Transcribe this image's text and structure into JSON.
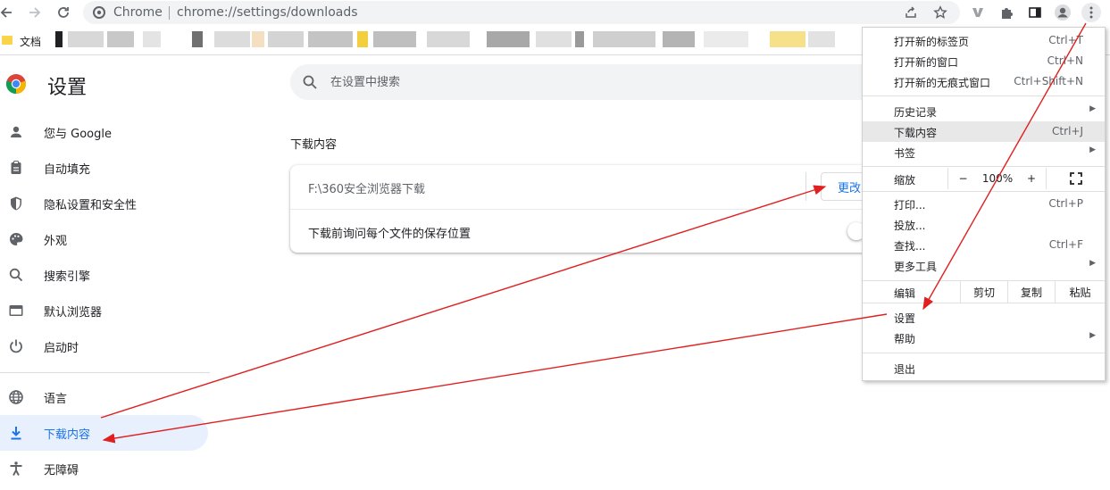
{
  "toolbar": {
    "site_name": "Chrome",
    "url": "chrome://settings/downloads",
    "icons": [
      "back-icon",
      "forward-icon",
      "reload-icon",
      "share-icon",
      "bookmark-star-icon",
      "extension-v-icon",
      "extensions-puzzle-icon",
      "side-panel-icon",
      "profile-icon",
      "menu-kebab-icon"
    ]
  },
  "bookmarks": {
    "first_label": "文档"
  },
  "sidebar": {
    "title": "设置",
    "items": [
      {
        "label": "您与 Google",
        "icon": "person-icon"
      },
      {
        "label": "自动填充",
        "icon": "clipboard-icon"
      },
      {
        "label": "隐私设置和安全性",
        "icon": "shield-icon"
      },
      {
        "label": "外观",
        "icon": "palette-icon"
      },
      {
        "label": "搜索引擎",
        "icon": "search-icon"
      },
      {
        "label": "默认浏览器",
        "icon": "browser-window-icon"
      },
      {
        "label": "启动时",
        "icon": "power-icon"
      },
      {
        "label": "语言",
        "icon": "globe-icon"
      },
      {
        "label": "下载内容",
        "icon": "download-icon"
      },
      {
        "label": "无障碍",
        "icon": "accessibility-icon"
      }
    ],
    "active_index": 8
  },
  "main": {
    "search_placeholder": "在设置中搜索",
    "section_title": "下载内容",
    "location_path": "F:\\360安全浏览器下载",
    "change_button": "更改",
    "ask_label": "下载前询问每个文件的保存位置",
    "ask_enabled": false
  },
  "menu": {
    "new_tab": {
      "label": "打开新的标签页",
      "shortcut": "Ctrl+T"
    },
    "new_window": {
      "label": "打开新的窗口",
      "shortcut": "Ctrl+N"
    },
    "incognito": {
      "label": "打开新的无痕式窗口",
      "shortcut": "Ctrl+Shift+N"
    },
    "history": {
      "label": "历史记录"
    },
    "downloads": {
      "label": "下载内容",
      "shortcut": "Ctrl+J"
    },
    "bookmarks": {
      "label": "书签"
    },
    "zoom": {
      "label": "缩放",
      "minus": "−",
      "value": "100%",
      "plus": "+"
    },
    "print": {
      "label": "打印...",
      "shortcut": "Ctrl+P"
    },
    "cast": {
      "label": "投放..."
    },
    "find": {
      "label": "查找...",
      "shortcut": "Ctrl+F"
    },
    "more_tools": {
      "label": "更多工具"
    },
    "edit": {
      "label": "编辑",
      "cut": "剪切",
      "copy": "复制",
      "paste": "粘贴"
    },
    "settings": {
      "label": "设置"
    },
    "help": {
      "label": "帮助"
    },
    "exit": {
      "label": "退出"
    }
  },
  "colors": {
    "accent": "#1a73e8",
    "active_bg": "#e8f0fe",
    "annotation_arrow": "#e02020"
  }
}
